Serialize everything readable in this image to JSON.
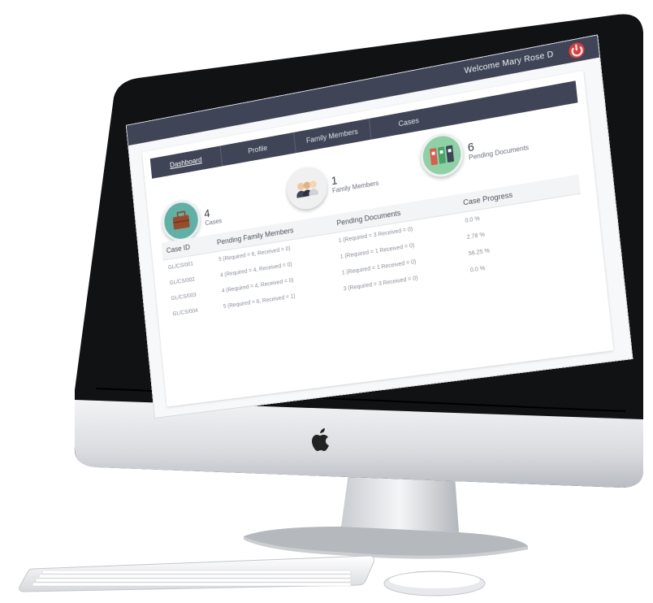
{
  "topbar": {
    "welcome": "Welcome Mary Rose D"
  },
  "nav": {
    "tabs": [
      "Dashboard",
      "Profile",
      "Family Members",
      "Cases"
    ],
    "active": "Dashboard"
  },
  "stats": [
    {
      "value": "4",
      "label": "Cases",
      "icon": "briefcase-icon"
    },
    {
      "value": "1",
      "label": "Family Members",
      "icon": "people-icon"
    },
    {
      "value": "6",
      "label": "Pending Documents",
      "icon": "binders-icon"
    }
  ],
  "table": {
    "headers": [
      "Case ID",
      "Pending Family Members",
      "Pending Documents",
      "Case Progress"
    ],
    "rows": [
      [
        "GL/CS/001",
        "5 (Required = 6, Received = 0)",
        "1 (Required = 3 Received = 0)",
        "0.0 %"
      ],
      [
        "GL/CS/002",
        "4 (Required = 4, Received = 0)",
        "1 (Required = 1 Received = 0)",
        "2.78 %"
      ],
      [
        "GL/CS/003",
        "4 (Required = 4, Received = 0)",
        "1 (Required = 1 Received = 0)",
        "56.25 %"
      ],
      [
        "GL/CS/004",
        "5 (Required = 6, Received = 1)",
        "3 (Required = 3 Received = 0)",
        "0.0 %"
      ]
    ]
  },
  "colors": {
    "navbar": "#3f4556",
    "power": "#e23a3a",
    "briefcase_circle": "#5fb1a6",
    "people_circle": "#f0f0f0",
    "binders_circle": "#8ed1a5",
    "binder_red": "#e05a4f",
    "binder_green": "#49a36a",
    "binder_dark": "#3f4556"
  }
}
